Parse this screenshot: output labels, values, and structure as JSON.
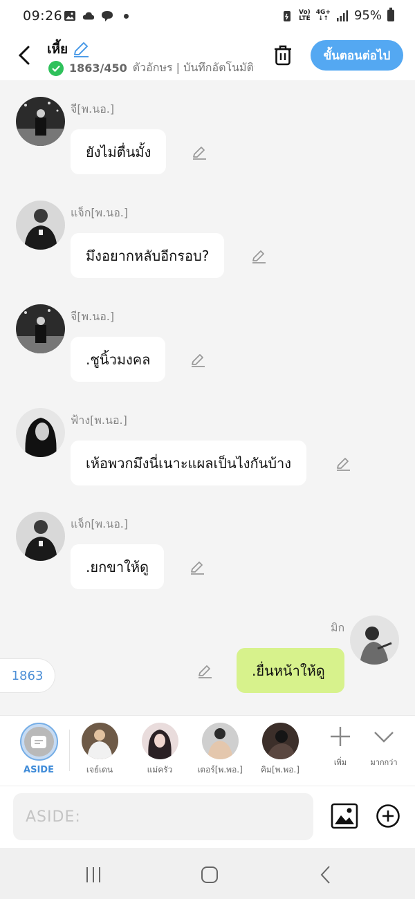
{
  "status_bar": {
    "time": "09:26",
    "battery": "95%",
    "network": "4G+",
    "volte": "VoLTE"
  },
  "header": {
    "title": "เหี้ย",
    "char_count": "1863/450",
    "subtitle_rest": "ตัวอักษร | บันทึกอัตโนมัติหลังจาก",
    "next_button": "ขั้นตอนต่อไป"
  },
  "messages": [
    {
      "sender": "จี[พ.นอ.]",
      "text": "ยังไม่ตื่นมั้ง"
    },
    {
      "sender": "แจ็ก[พ.นอ.]",
      "text": "มึงอยากหลับอีกรอบ?"
    },
    {
      "sender": "จี[พ.นอ.]",
      "text": ".ชูนิ้วมงคล"
    },
    {
      "sender": "ฟ้าง[พ.นอ.]",
      "text": "เห้อพวกมึงนี่เนาะแผลเป็นไงกันบ้าง"
    },
    {
      "sender": "แจ็ก[พ.นอ.]",
      "text": ".ยกขาให้ดู"
    },
    {
      "sender": "มิก",
      "text": ".ยื่นหน้าให้ดู",
      "mine": true
    }
  ],
  "count_pill": "1863",
  "characters": {
    "aside_label": "ASIDE",
    "items": [
      {
        "name": "เจย์เดน"
      },
      {
        "name": "แม่ครัว"
      },
      {
        "name": "เตอร์[พ.พอ.]"
      },
      {
        "name": "คิม[พ.พอ.]"
      }
    ],
    "add_label": "เพิ่ม",
    "more_label": "มากกว่า"
  },
  "input": {
    "placeholder": "ASIDE:"
  },
  "colors": {
    "accent": "#54a8f2",
    "my_bubble": "#d7f28c",
    "check": "#2fc15b"
  }
}
